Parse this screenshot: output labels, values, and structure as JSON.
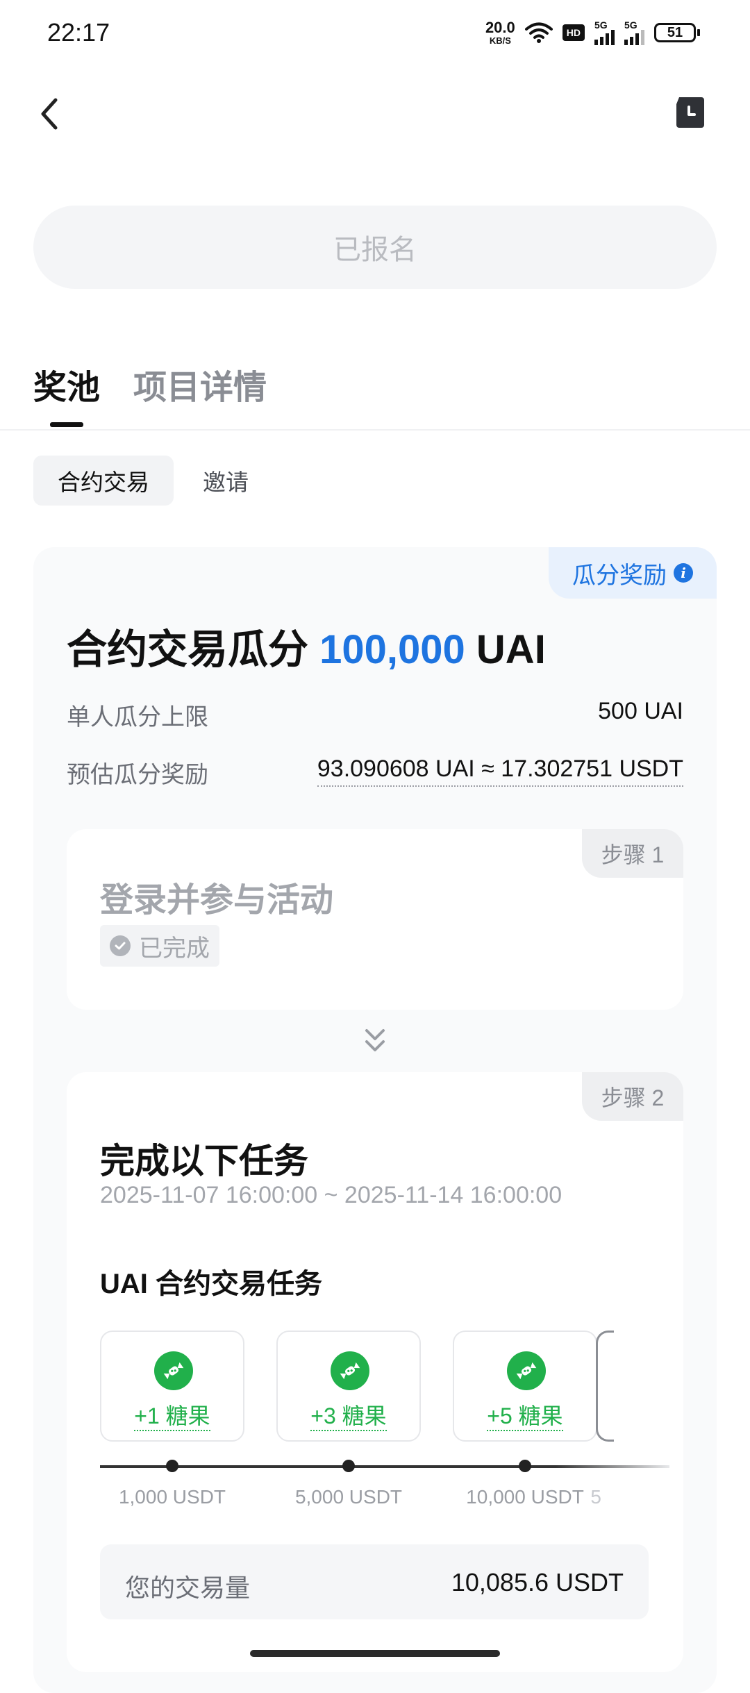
{
  "status_bar": {
    "time": "22:17",
    "net_speed": "20.0",
    "net_unit": "KB/S",
    "hd": "HD",
    "sim1": "5G",
    "sim2": "5G",
    "battery": "51"
  },
  "header": {
    "back_icon": "chevron-left-icon",
    "history_icon": "history-icon"
  },
  "signed_button": "已报名",
  "tabs": [
    {
      "label": "奖池",
      "active": true
    },
    {
      "label": "项目详情",
      "active": false
    }
  ],
  "subtabs": [
    {
      "label": "合约交易",
      "active": true
    },
    {
      "label": "邀请",
      "active": false
    }
  ],
  "card": {
    "badge": "瓜分奖励",
    "title_prefix": "合约交易瓜分",
    "title_amount": "100,000",
    "title_token": "UAI",
    "rows": [
      {
        "label": "单人瓜分上限",
        "value": "500 UAI"
      },
      {
        "label": "预估瓜分奖励",
        "value": "93.090608 UAI ≈ 17.302751 USDT"
      }
    ]
  },
  "step1": {
    "tag": "步骤 1",
    "title": "登录并参与活动",
    "status": "已完成"
  },
  "step2": {
    "tag": "步骤 2",
    "title": "完成以下任务",
    "time_range": "2025-11-07 16:00:00 ~ 2025-11-14 16:00:00",
    "task_title": "UAI 合约交易任务",
    "tiers": [
      {
        "reward": "+1 糖果",
        "threshold": "1,000 USDT"
      },
      {
        "reward": "+3 糖果",
        "threshold": "5,000 USDT"
      },
      {
        "reward": "+5 糖果",
        "threshold": "10,000 USDT"
      },
      {
        "reward": "",
        "threshold": "5"
      }
    ],
    "volume_label": "您的交易量",
    "volume_value": "10,085.6 USDT"
  },
  "colors": {
    "accent": "#1e74e0",
    "candy_green": "#21b04b",
    "muted": "#a3a6ac"
  }
}
